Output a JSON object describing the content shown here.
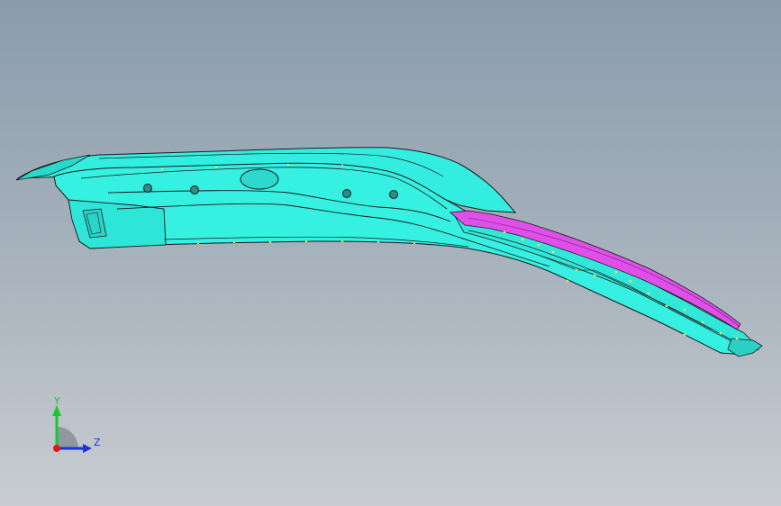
{
  "viewport": {
    "background_top": "#8a9cab",
    "background_bottom": "#c9cdd2"
  },
  "model": {
    "body_color": "#33eee0",
    "accent_color": "#e050e8",
    "edge_color": "#1a1a1a",
    "hole_color": "#2a8f87",
    "marker_color": "#e8e05a"
  },
  "triad": {
    "y_label": "Y",
    "z_label": "Z",
    "y_color": "#18c82a",
    "z_color": "#1a36d8",
    "x_color": "#e01818",
    "icon": "coordinate-triad-icon"
  }
}
